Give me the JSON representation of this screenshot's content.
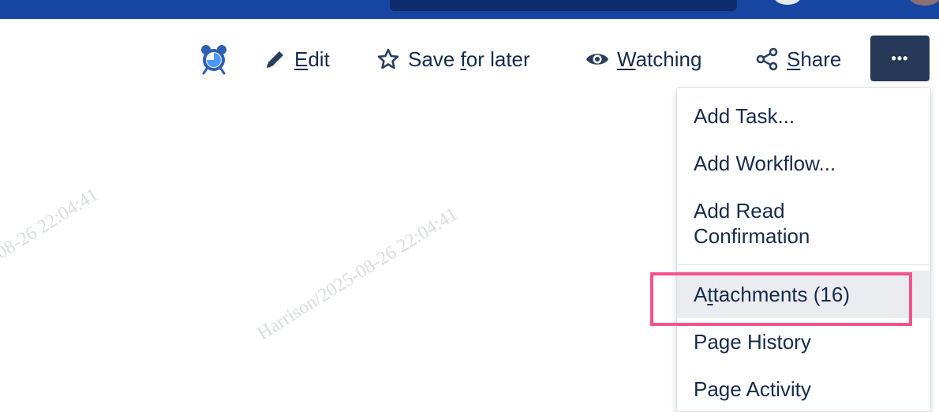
{
  "toolbar": {
    "edit_label_u": "E",
    "edit_label_rest": "dit",
    "save_label_pre": "Save ",
    "save_label_u": "f",
    "save_label_rest": "or later",
    "watch_label_u": "W",
    "watch_label_rest": "atching",
    "share_label_u": "S",
    "share_label_rest": "hare",
    "more_label": "•••"
  },
  "watermarks": [
    "-08-26 22:04:41",
    "Harrison/2025-08-26 22:04:41"
  ],
  "menu": {
    "items": [
      {
        "label": "Add Task..."
      },
      {
        "label": "Add Workflow..."
      },
      {
        "label_line1": "Add Read",
        "label_line2": "Confirmation"
      },
      {
        "label_pre": "A",
        "label_u": "t",
        "label_rest": "tachments (16)"
      },
      {
        "label": "Page History"
      },
      {
        "label": "Page Activity"
      }
    ]
  },
  "colors": {
    "topbar": "#1746a2",
    "more_button": "#253858",
    "highlight": "#f5538a"
  },
  "icons": [
    "alarm-clock-icon",
    "pencil-icon",
    "star-icon",
    "eye-icon",
    "share-icon",
    "more-icon"
  ]
}
